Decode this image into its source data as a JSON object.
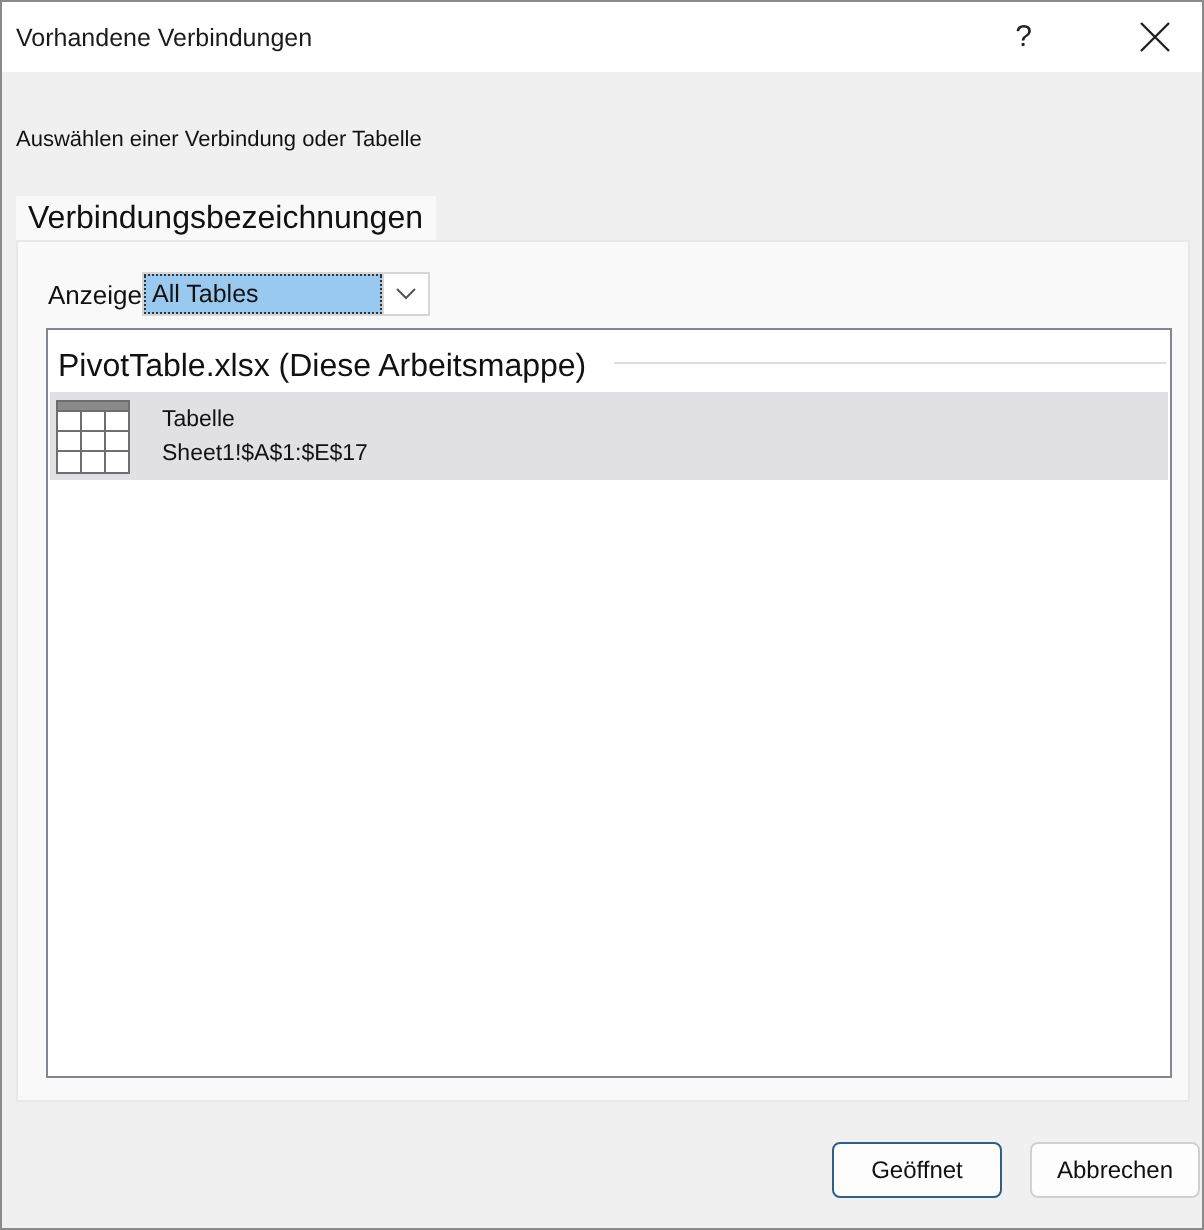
{
  "window": {
    "title": "Vorhandene Verbindungen",
    "help": "?"
  },
  "instruction": "Auswählen einer Verbindung oder Tabelle",
  "tabs": [
    {
      "label": "Verbindungsbezeichnungen",
      "selected": true
    }
  ],
  "filter": {
    "label": "Anzeige",
    "value": "All Tables",
    "highlighted": true
  },
  "list": {
    "groups": [
      {
        "title": "PivotTable.xlsx (Diese Arbeitsmappe)",
        "items": [
          {
            "name": "Tabelle",
            "range": "Sheet1!$A$1:$E$17",
            "selected": true
          }
        ]
      }
    ]
  },
  "buttons": [
    {
      "label": "Geöffnet",
      "default": true
    },
    {
      "label": "Abbrechen",
      "default": false
    }
  ]
}
